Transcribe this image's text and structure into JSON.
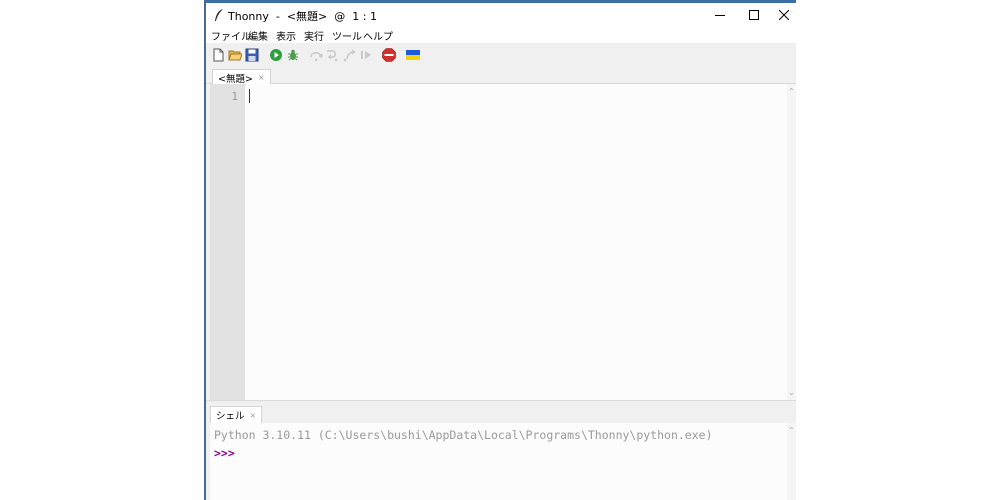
{
  "window": {
    "title": "Thonny  -  <無題>  @  1 : 1",
    "controls": [
      "minimize-icon",
      "maximize-icon",
      "close-icon"
    ]
  },
  "menu": {
    "items": [
      "ファイル",
      "編集",
      "表示",
      "実行",
      "ツール",
      "ヘルプ"
    ]
  },
  "toolbar": {
    "icons": [
      "new-file-icon",
      "open-folder-icon",
      "save-icon",
      "run-icon",
      "debug-icon",
      "step-over-icon",
      "step-into-icon",
      "step-out-icon",
      "resume-icon",
      "stop-icon",
      "ukraine-flag-icon"
    ],
    "colors": {
      "run": "#2e9e3e",
      "stop": "#d32f2f",
      "flag_top": "#1e5bd8",
      "flag_bottom": "#f5d000"
    }
  },
  "editor": {
    "tab_label": "<無題>",
    "tab_close": "×",
    "line_numbers": [
      "1"
    ],
    "content": ""
  },
  "shell": {
    "tab_label": "シェル",
    "tab_close": "×",
    "banner": "Python 3.10.11 (C:\\Users\\bushi\\AppData\\Local\\Programs\\Thonny\\python.exe)",
    "prompt": ">>>",
    "colors": {
      "prompt": "#8b008b",
      "banner": "#999999"
    }
  }
}
